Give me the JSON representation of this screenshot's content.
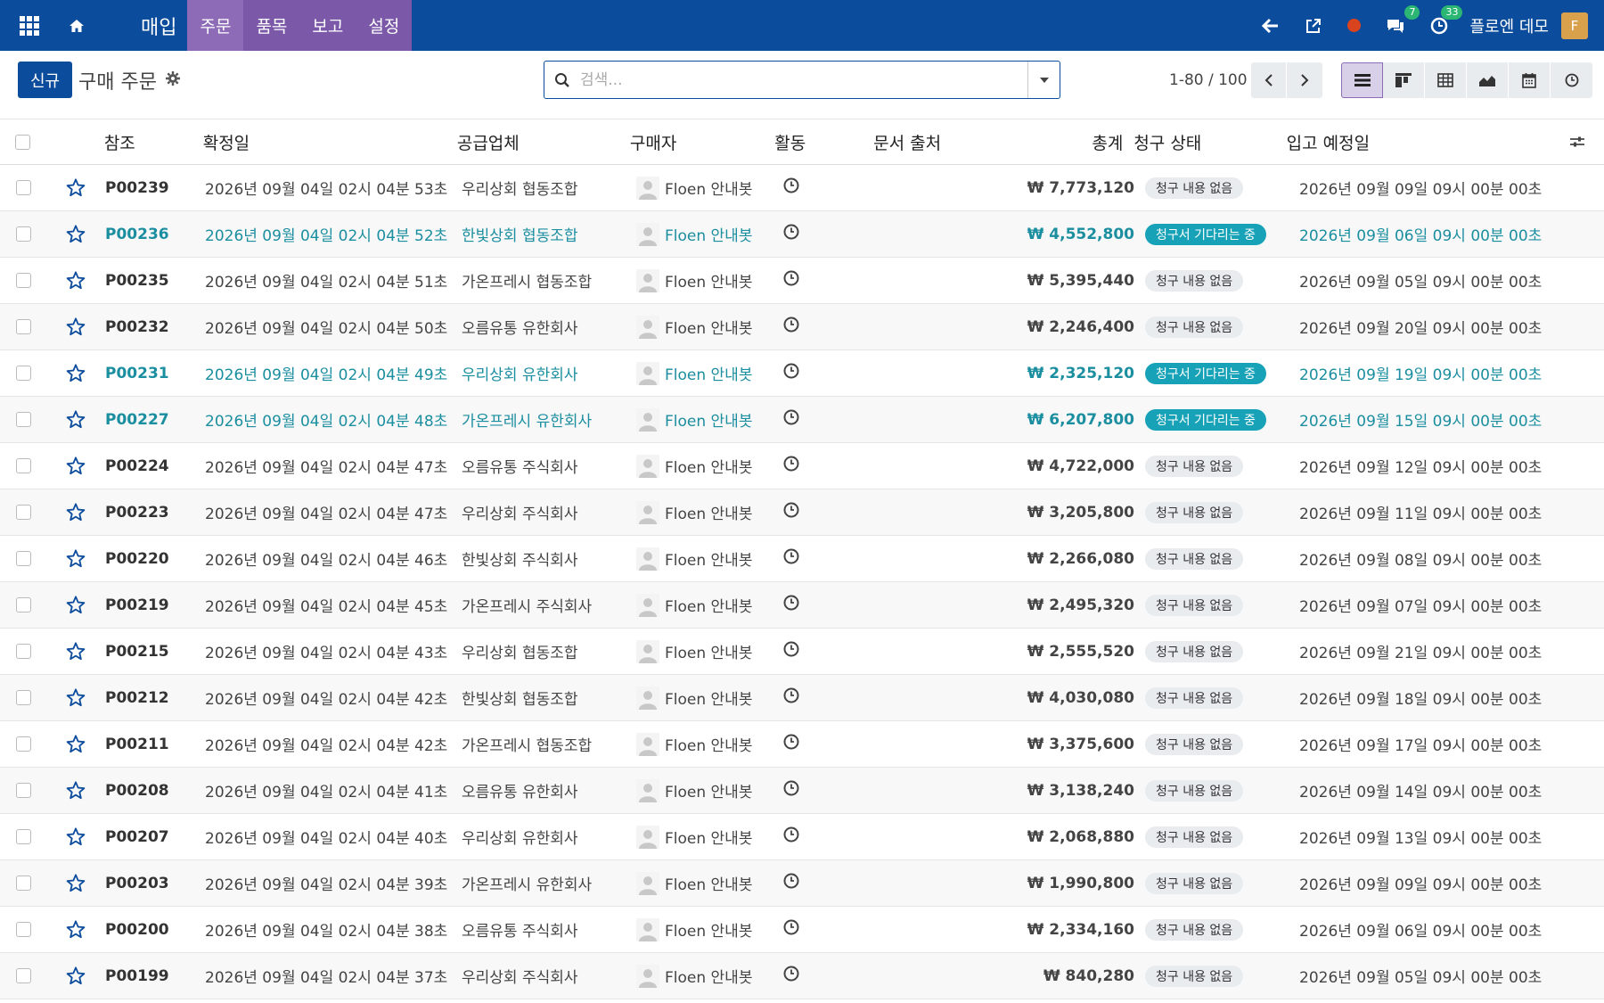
{
  "navbar": {
    "app_name": "매입",
    "menu": [
      "주문",
      "품목",
      "보고",
      "설정"
    ],
    "messages_count": "7",
    "activities_count": "33",
    "company": "플로엔 데모",
    "user_initial": "F",
    "brand_color": "#0c4c9c",
    "menu_color": "#7b58a8"
  },
  "control": {
    "new_label": "신규",
    "title": "구매 주문",
    "search_placeholder": "검색...",
    "pager": "1-80 / 100"
  },
  "table": {
    "headers": {
      "ref": "참조",
      "date": "확정일",
      "vendor": "공급업체",
      "buyer": "구매자",
      "activity": "활동",
      "source": "문서 출처",
      "total": "총계",
      "status": "청구 상태",
      "eta": "입고 예정일"
    },
    "rows": [
      {
        "ref": "P00239",
        "date": "2026년 09월 04일 02시 04분 53초",
        "vendor": "우리상회 협동조합",
        "buyer": "Floen 안내봇",
        "total": "₩ 7,773,120",
        "status": "청구 내용 없음",
        "waiting": false,
        "eta": "2026년 09월 09일 09시 00분 00초"
      },
      {
        "ref": "P00236",
        "date": "2026년 09월 04일 02시 04분 52초",
        "vendor": "한빛상회 협동조합",
        "buyer": "Floen 안내봇",
        "total": "₩ 4,552,800",
        "status": "청구서 기다리는 중",
        "waiting": true,
        "eta": "2026년 09월 06일 09시 00분 00초"
      },
      {
        "ref": "P00235",
        "date": "2026년 09월 04일 02시 04분 51초",
        "vendor": "가온프레시 협동조합",
        "buyer": "Floen 안내봇",
        "total": "₩ 5,395,440",
        "status": "청구 내용 없음",
        "waiting": false,
        "eta": "2026년 09월 05일 09시 00분 00초"
      },
      {
        "ref": "P00232",
        "date": "2026년 09월 04일 02시 04분 50초",
        "vendor": "오름유통 유한회사",
        "buyer": "Floen 안내봇",
        "total": "₩ 2,246,400",
        "status": "청구 내용 없음",
        "waiting": false,
        "eta": "2026년 09월 20일 09시 00분 00초"
      },
      {
        "ref": "P00231",
        "date": "2026년 09월 04일 02시 04분 49초",
        "vendor": "우리상회 유한회사",
        "buyer": "Floen 안내봇",
        "total": "₩ 2,325,120",
        "status": "청구서 기다리는 중",
        "waiting": true,
        "eta": "2026년 09월 19일 09시 00분 00초"
      },
      {
        "ref": "P00227",
        "date": "2026년 09월 04일 02시 04분 48초",
        "vendor": "가온프레시 유한회사",
        "buyer": "Floen 안내봇",
        "total": "₩ 6,207,800",
        "status": "청구서 기다리는 중",
        "waiting": true,
        "eta": "2026년 09월 15일 09시 00분 00초"
      },
      {
        "ref": "P00224",
        "date": "2026년 09월 04일 02시 04분 47초",
        "vendor": "오름유통 주식회사",
        "buyer": "Floen 안내봇",
        "total": "₩ 4,722,000",
        "status": "청구 내용 없음",
        "waiting": false,
        "eta": "2026년 09월 12일 09시 00분 00초"
      },
      {
        "ref": "P00223",
        "date": "2026년 09월 04일 02시 04분 47초",
        "vendor": "우리상회 주식회사",
        "buyer": "Floen 안내봇",
        "total": "₩ 3,205,800",
        "status": "청구 내용 없음",
        "waiting": false,
        "eta": "2026년 09월 11일 09시 00분 00초"
      },
      {
        "ref": "P00220",
        "date": "2026년 09월 04일 02시 04분 46초",
        "vendor": "한빛상회 주식회사",
        "buyer": "Floen 안내봇",
        "total": "₩ 2,266,080",
        "status": "청구 내용 없음",
        "waiting": false,
        "eta": "2026년 09월 08일 09시 00분 00초"
      },
      {
        "ref": "P00219",
        "date": "2026년 09월 04일 02시 04분 45초",
        "vendor": "가온프레시 주식회사",
        "buyer": "Floen 안내봇",
        "total": "₩ 2,495,320",
        "status": "청구 내용 없음",
        "waiting": false,
        "eta": "2026년 09월 07일 09시 00분 00초"
      },
      {
        "ref": "P00215",
        "date": "2026년 09월 04일 02시 04분 43초",
        "vendor": "우리상회 협동조합",
        "buyer": "Floen 안내봇",
        "total": "₩ 2,555,520",
        "status": "청구 내용 없음",
        "waiting": false,
        "eta": "2026년 09월 21일 09시 00분 00초"
      },
      {
        "ref": "P00212",
        "date": "2026년 09월 04일 02시 04분 42초",
        "vendor": "한빛상회 협동조합",
        "buyer": "Floen 안내봇",
        "total": "₩ 4,030,080",
        "status": "청구 내용 없음",
        "waiting": false,
        "eta": "2026년 09월 18일 09시 00분 00초"
      },
      {
        "ref": "P00211",
        "date": "2026년 09월 04일 02시 04분 42초",
        "vendor": "가온프레시 협동조합",
        "buyer": "Floen 안내봇",
        "total": "₩ 3,375,600",
        "status": "청구 내용 없음",
        "waiting": false,
        "eta": "2026년 09월 17일 09시 00분 00초"
      },
      {
        "ref": "P00208",
        "date": "2026년 09월 04일 02시 04분 41초",
        "vendor": "오름유통 유한회사",
        "buyer": "Floen 안내봇",
        "total": "₩ 3,138,240",
        "status": "청구 내용 없음",
        "waiting": false,
        "eta": "2026년 09월 14일 09시 00분 00초"
      },
      {
        "ref": "P00207",
        "date": "2026년 09월 04일 02시 04분 40초",
        "vendor": "우리상회 유한회사",
        "buyer": "Floen 안내봇",
        "total": "₩ 2,068,880",
        "status": "청구 내용 없음",
        "waiting": false,
        "eta": "2026년 09월 13일 09시 00분 00초"
      },
      {
        "ref": "P00203",
        "date": "2026년 09월 04일 02시 04분 39초",
        "vendor": "가온프레시 유한회사",
        "buyer": "Floen 안내봇",
        "total": "₩ 1,990,800",
        "status": "청구 내용 없음",
        "waiting": false,
        "eta": "2026년 09월 09일 09시 00분 00초"
      },
      {
        "ref": "P00200",
        "date": "2026년 09월 04일 02시 04분 38초",
        "vendor": "오름유통 주식회사",
        "buyer": "Floen 안내봇",
        "total": "₩ 2,334,160",
        "status": "청구 내용 없음",
        "waiting": false,
        "eta": "2026년 09월 06일 09시 00분 00초"
      },
      {
        "ref": "P00199",
        "date": "2026년 09월 04일 02시 04분 37초",
        "vendor": "우리상회 주식회사",
        "buyer": "Floen 안내봇",
        "total": "₩ 840,280",
        "status": "청구 내용 없음",
        "waiting": false,
        "eta": "2026년 09월 05일 09시 00분 00초"
      }
    ]
  }
}
